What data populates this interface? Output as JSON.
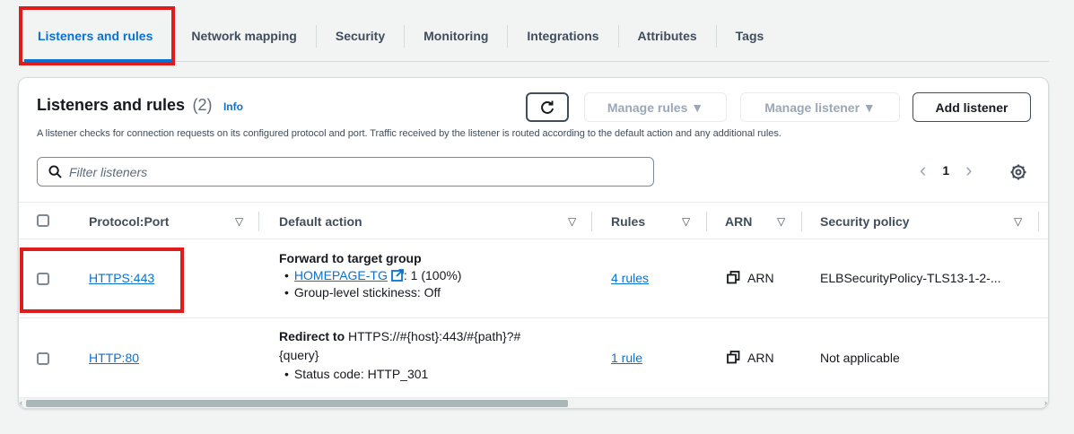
{
  "tabs": [
    {
      "label": "Listeners and rules"
    },
    {
      "label": "Network mapping"
    },
    {
      "label": "Security"
    },
    {
      "label": "Monitoring"
    },
    {
      "label": "Integrations"
    },
    {
      "label": "Attributes"
    },
    {
      "label": "Tags"
    }
  ],
  "panel": {
    "title": "Listeners and rules",
    "count": "(2)",
    "info": "Info",
    "description": "A listener checks for connection requests on its configured protocol and port. Traffic received by the listener is routed according to the default action and any additional rules.",
    "manage_rules": "Manage rules ▼",
    "manage_listener": "Manage listener ▼",
    "add_listener": "Add listener",
    "filter_placeholder": "Filter listeners",
    "page": "1"
  },
  "columns": {
    "protocol_port": "Protocol:Port",
    "default_action": "Default action",
    "rules": "Rules",
    "arn": "ARN",
    "security_policy": "Security policy"
  },
  "rows": [
    {
      "protocol_port": "HTTPS:443",
      "action_title": "Forward to target group",
      "target_group": "HOMEPAGE-TG",
      "target_weight": ": 1 (100%)",
      "stickiness": "Group-level stickiness: Off",
      "rules": "4 rules",
      "arn": "ARN",
      "security_policy": "ELBSecurityPolicy-TLS13-1-2-..."
    },
    {
      "protocol_port": "HTTP:80",
      "action_title": "Redirect to",
      "redirect_target_1": " HTTPS://#{host}:443/#{path}?#",
      "redirect_target_2": "{query}",
      "status_code": "Status code: HTTP_301",
      "rules": "1 rule",
      "arn": "ARN",
      "security_policy": "Not applicable"
    }
  ],
  "colors": {
    "accent": "#0972d3",
    "highlight": "#e01b1b",
    "text": "#16191f",
    "muted": "#414d5c"
  }
}
